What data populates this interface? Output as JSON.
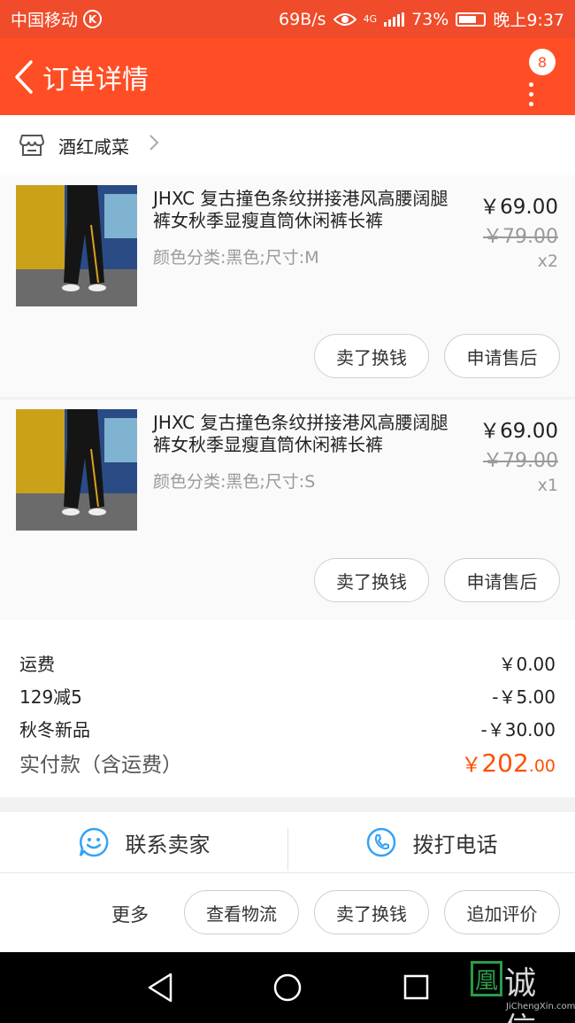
{
  "status": {
    "carrier": "中国移动",
    "carrier_badge": "K",
    "speed": "69B/s",
    "network": "4G",
    "battery": "73%",
    "battery_level": 0.73,
    "time": "晚上9:37"
  },
  "header": {
    "title": "订单详情",
    "badge_count": "8"
  },
  "shop": {
    "name": "酒红咸菜"
  },
  "items": [
    {
      "title": "JHXC 复古撞色条纹拼接港风高腰阔腿裤女秋季显瘦直筒休闲裤长裤",
      "spec": "颜色分类:黑色;尺寸:M",
      "price": "￥69.00",
      "original_price": "￥79.00",
      "quantity": "x2",
      "sell_label": "卖了换钱",
      "after_sale_label": "申请售后"
    },
    {
      "title": "JHXC 复古撞色条纹拼接港风高腰阔腿裤女秋季显瘦直筒休闲裤长裤",
      "spec": "颜色分类:黑色;尺寸:S",
      "price": "￥69.00",
      "original_price": "￥79.00",
      "quantity": "x1",
      "sell_label": "卖了换钱",
      "after_sale_label": "申请售后"
    }
  ],
  "summary": {
    "rows": [
      {
        "label": "运费",
        "value": "￥0.00"
      },
      {
        "label": "129减5",
        "value": "-￥5.00"
      },
      {
        "label": "秋冬新品",
        "value": "-￥30.00"
      }
    ],
    "total_label": "实付款（含运费）",
    "total_currency": "￥",
    "total_int": "202",
    "total_dec": ".00"
  },
  "actions": {
    "contact_seller": "联系卖家",
    "call_phone": "拨打电话",
    "more": "更多",
    "logistics": "查看物流",
    "sell": "卖了换钱",
    "add_review": "追加评价"
  },
  "watermark": {
    "text": "诚信",
    "logo_char": "凰",
    "sub": "JiChengXin.com"
  },
  "colors": {
    "brand": "#ff4e25",
    "price_accent": "#ff5000",
    "icon_blue": "#33a3f4"
  }
}
